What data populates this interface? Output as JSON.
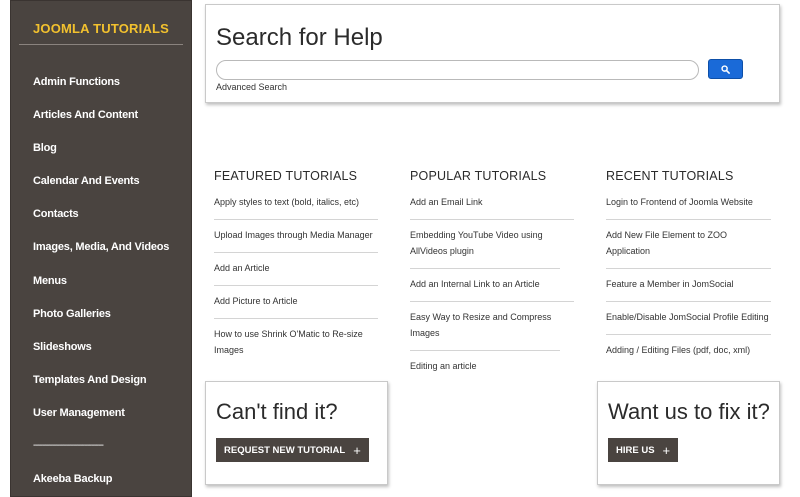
{
  "sidebar": {
    "title": "JOOMLA TUTORIALS",
    "items": [
      {
        "label": "Admin Functions"
      },
      {
        "label": "Articles And Content"
      },
      {
        "label": "Blog"
      },
      {
        "label": "Calendar And Events"
      },
      {
        "label": "Contacts"
      },
      {
        "label": "Images, Media, And Videos"
      },
      {
        "label": "Menus"
      },
      {
        "label": "Photo Galleries"
      },
      {
        "label": "Slideshows"
      },
      {
        "label": "Templates And Design"
      },
      {
        "label": "User Management"
      }
    ],
    "separator": "------------------------------",
    "extra_items": [
      {
        "label": "Akeeba Backup"
      }
    ]
  },
  "search": {
    "title": "Search for Help",
    "value": "",
    "placeholder": "",
    "button_icon": "search-icon",
    "advanced_label": "Advanced Search"
  },
  "featured": {
    "heading": "FEATURED TUTORIALS",
    "links": [
      "Apply styles to text (bold, italics, etc)",
      "Upload Images through Media Manager",
      "Add an Article",
      "Add Picture to Article",
      "How to use Shrink O'Matic to Re-size Images"
    ]
  },
  "popular": {
    "heading": "POPULAR TUTORIALS",
    "links": [
      "Add an Email Link",
      "Embedding YouTube Video using AllVideos plugin",
      "Add an Internal Link to an Article",
      "Easy Way to Resize and Compress Images",
      "Editing an article"
    ]
  },
  "recent": {
    "heading": "RECENT TUTORIALS",
    "links": [
      "Login to Frontend of Joomla Website",
      "Add New File Element to ZOO Application",
      "Feature a Member in JomSocial",
      "Enable/Disable JomSocial Profile Editing",
      "Adding / Editing Files (pdf, doc, xml)"
    ]
  },
  "cta_left": {
    "title": "Can't find it?",
    "button_label": "REQUEST NEW TUTORIAL",
    "button_icon": "plus-icon"
  },
  "cta_right": {
    "title": "Want us to fix it?",
    "button_label": "HIRE US",
    "button_icon": "plus-icon"
  },
  "colors": {
    "sidebar_bg": "#4a4440",
    "sidebar_title": "#f2c12e",
    "search_button": "#1a6ad8"
  }
}
